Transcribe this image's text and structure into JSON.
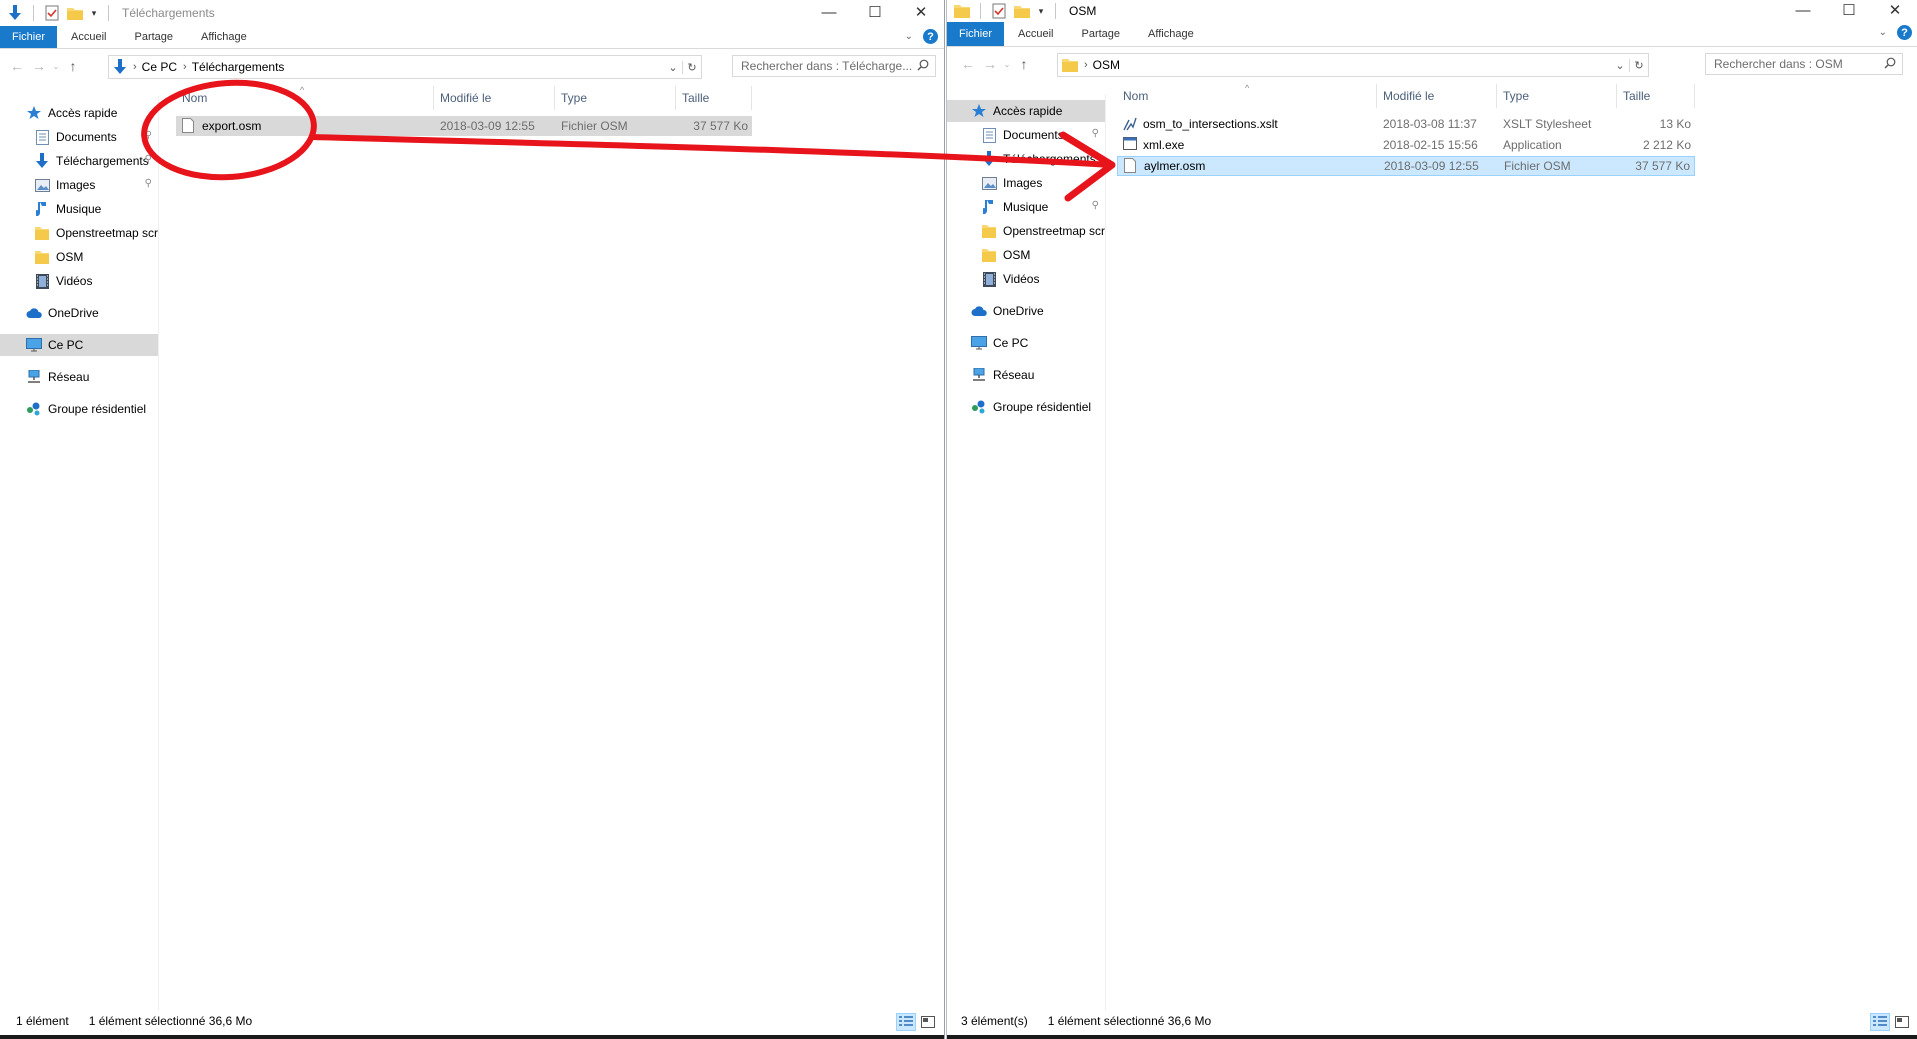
{
  "left_window": {
    "title": "Téléchargements",
    "ribbon_tabs": [
      "Fichier",
      "Accueil",
      "Partage",
      "Affichage"
    ],
    "address": {
      "crumbs": [
        "Ce PC",
        "Téléchargements"
      ]
    },
    "search_placeholder": "Rechercher dans : Télécharge...",
    "nav": {
      "quick_access": "Accès rapide",
      "items": [
        "Documents",
        "Téléchargements",
        "Images",
        "Musique",
        "Openstreetmap scre",
        "OSM",
        "Vidéos"
      ],
      "onedrive": "OneDrive",
      "this_pc": "Ce PC",
      "network": "Réseau",
      "homegroup": "Groupe résidentiel"
    },
    "columns": [
      "Nom",
      "Modifié le",
      "Type",
      "Taille"
    ],
    "files": [
      {
        "name": "export.osm",
        "modified": "2018-03-09 12:55",
        "type": "Fichier OSM",
        "size": "37 577 Ko"
      }
    ],
    "status": {
      "count": "1 élément",
      "selection": "1 élément sélectionné 36,6 Mo"
    }
  },
  "right_window": {
    "title": "OSM",
    "ribbon_tabs": [
      "Fichier",
      "Accueil",
      "Partage",
      "Affichage"
    ],
    "address": {
      "crumbs": [
        "OSM"
      ]
    },
    "search_placeholder": "Rechercher dans : OSM",
    "nav": {
      "quick_access": "Accès rapide",
      "items": [
        "Documents",
        "Téléchargements",
        "Images",
        "Musique",
        "Openstreetmap scre",
        "OSM",
        "Vidéos"
      ],
      "onedrive": "OneDrive",
      "this_pc": "Ce PC",
      "network": "Réseau",
      "homegroup": "Groupe résidentiel"
    },
    "columns": [
      "Nom",
      "Modifié le",
      "Type",
      "Taille"
    ],
    "files": [
      {
        "name": "osm_to_intersections.xslt",
        "modified": "2018-03-08 11:37",
        "type": "XSLT Stylesheet",
        "size": "13 Ko",
        "icon": "xslt-file-icon"
      },
      {
        "name": "xml.exe",
        "modified": "2018-02-15 15:56",
        "type": "Application",
        "size": "2 212 Ko",
        "icon": "exe-file-icon"
      },
      {
        "name": "aylmer.osm",
        "modified": "2018-03-09 12:55",
        "type": "Fichier OSM",
        "size": "37 577 Ko",
        "icon": "file-icon"
      }
    ],
    "status": {
      "count": "3 élément(s)",
      "selection": "1 élément sélectionné 36,6 Mo"
    }
  },
  "annotation": {
    "color": "#e8141b",
    "shapes": [
      "ellipse-around-export-osm",
      "arrow-to-aylmer-osm"
    ]
  }
}
